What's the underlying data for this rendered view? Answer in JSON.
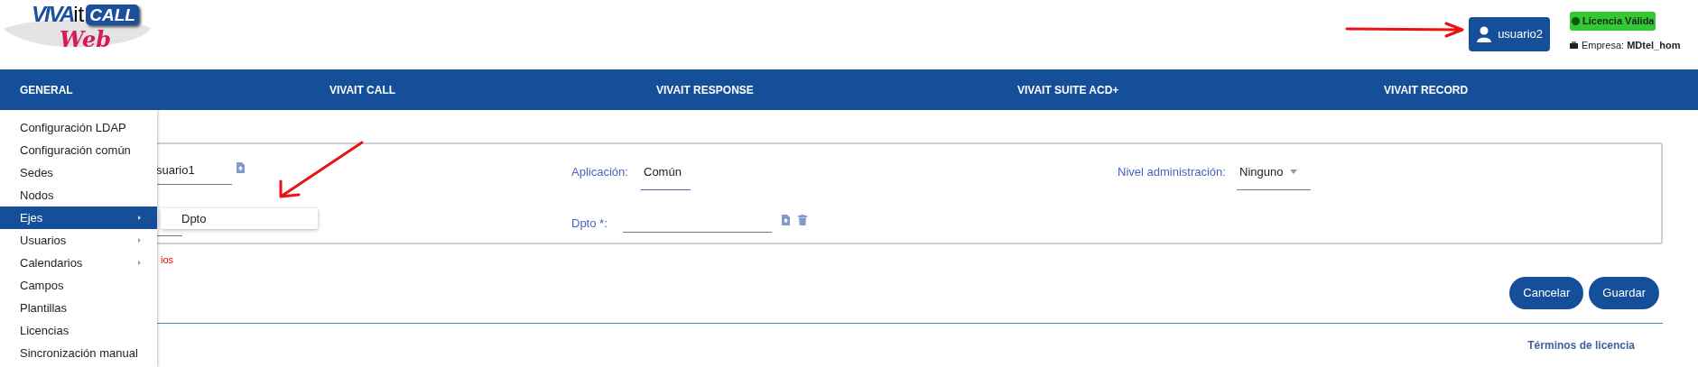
{
  "logo": {
    "brand": "VIVA",
    "suffix": "it",
    "badge": "CALL",
    "script": "Web"
  },
  "user_button": {
    "label": "usuario2"
  },
  "license_badge": {
    "label": "Licencia Válida",
    "valid": true
  },
  "company": {
    "text": "Empresa: **MDtel_hom**"
  },
  "nav": [
    {
      "label": "GENERAL"
    },
    {
      "label": "VIVAIT CALL"
    },
    {
      "label": "VIVAIT RESPONSE"
    },
    {
      "label": "VIVAIT SUITE ACD+"
    },
    {
      "label": "VIVAIT RECORD"
    }
  ],
  "menu": [
    {
      "label": "Configuración LDAP",
      "selected": false,
      "has_submenu": false
    },
    {
      "label": "Configuración común",
      "selected": false,
      "has_submenu": false
    },
    {
      "label": "Sedes",
      "selected": false,
      "has_submenu": false
    },
    {
      "label": "Nodos",
      "selected": false,
      "has_submenu": false
    },
    {
      "label": "Ejes",
      "selected": true,
      "has_submenu": true
    },
    {
      "label": "Usuarios",
      "selected": false,
      "has_submenu": true
    },
    {
      "label": "Calendarios",
      "selected": false,
      "has_submenu": true
    },
    {
      "label": "Campos",
      "selected": false,
      "has_submenu": false
    },
    {
      "label": "Plantillas",
      "selected": false,
      "has_submenu": false
    },
    {
      "label": "Licencias",
      "selected": false,
      "has_submenu": false
    },
    {
      "label": "Sincronización manual",
      "selected": false,
      "has_submenu": false
    }
  ],
  "submenu": [
    {
      "label": "Dpto"
    }
  ],
  "form": {
    "user_value": "suario1",
    "application_label": "Aplicación:",
    "application_value": "Común",
    "admin_label": "Nivel administración:",
    "admin_value": "Ninguno",
    "dpto_label": "Dpto *:",
    "error_text": "ios"
  },
  "buttons": [
    {
      "label": "Cancelar"
    },
    {
      "label": "Guardar"
    }
  ],
  "footer_link": "Términos de licencia"
}
